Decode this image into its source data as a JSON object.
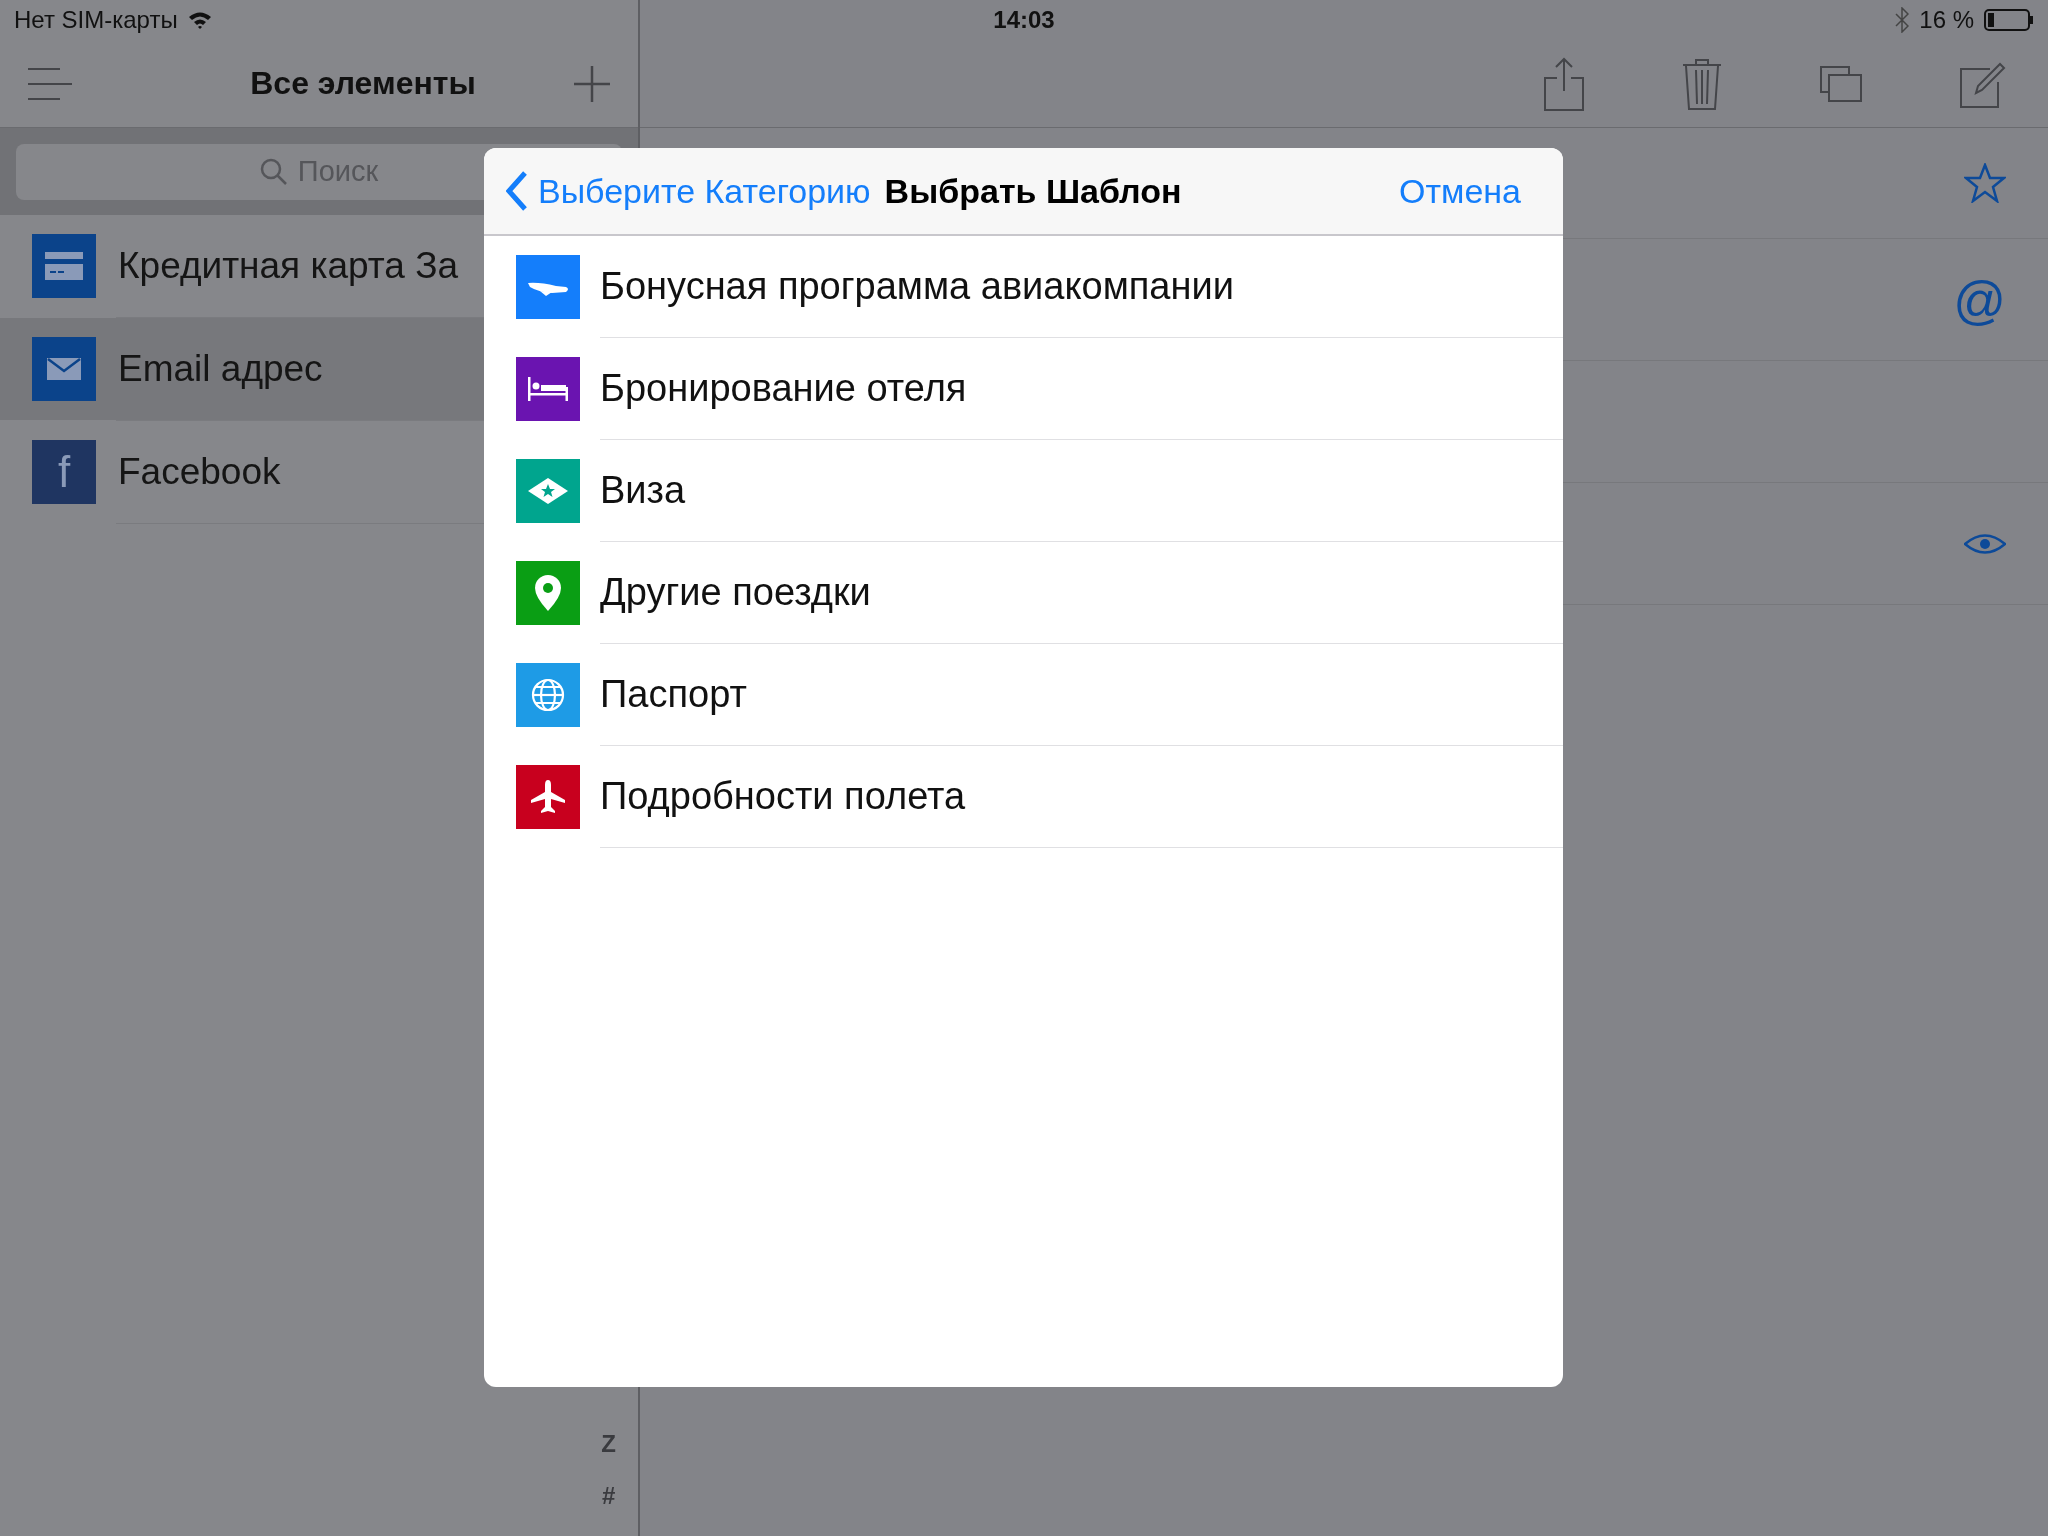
{
  "status_bar": {
    "carrier": "Нет SIM-карты",
    "time": "14:03",
    "battery": "16 %"
  },
  "sidebar": {
    "title": "Все элементы",
    "search": {
      "placeholder": "Поиск"
    },
    "items": [
      {
        "kind": "credit-card",
        "label": "Кредитная карта За",
        "selected": false
      },
      {
        "kind": "email",
        "label": "Email адрес",
        "selected": true
      },
      {
        "kind": "facebook",
        "glyph": "f",
        "label": "Facebook",
        "selected": false
      }
    ],
    "index_letters": [
      "Z",
      "#"
    ]
  },
  "detail": {
    "rows": [
      {
        "kind": "star"
      },
      {
        "kind": "at",
        "glyph": "@"
      },
      {
        "kind": "blank"
      },
      {
        "kind": "eye"
      }
    ]
  },
  "dialog": {
    "back": "Выберите Категорию",
    "title": "Выбрать Шаблон",
    "cancel": "Отмена",
    "items": [
      {
        "kind": "airline",
        "label": "Бонусная программа авиакомпании",
        "color": "#147efb"
      },
      {
        "kind": "hotel",
        "label": "Бронирование отеля",
        "color": "#6a14b0"
      },
      {
        "kind": "visa",
        "label": "Виза",
        "color": "#00a58e"
      },
      {
        "kind": "pin",
        "label": "Другие поездки",
        "color": "#0a9e14"
      },
      {
        "kind": "globe",
        "label": "Паспорт",
        "color": "#1e9be6"
      },
      {
        "kind": "plane",
        "label": "Подробности полета",
        "color": "#c8001e"
      }
    ]
  }
}
